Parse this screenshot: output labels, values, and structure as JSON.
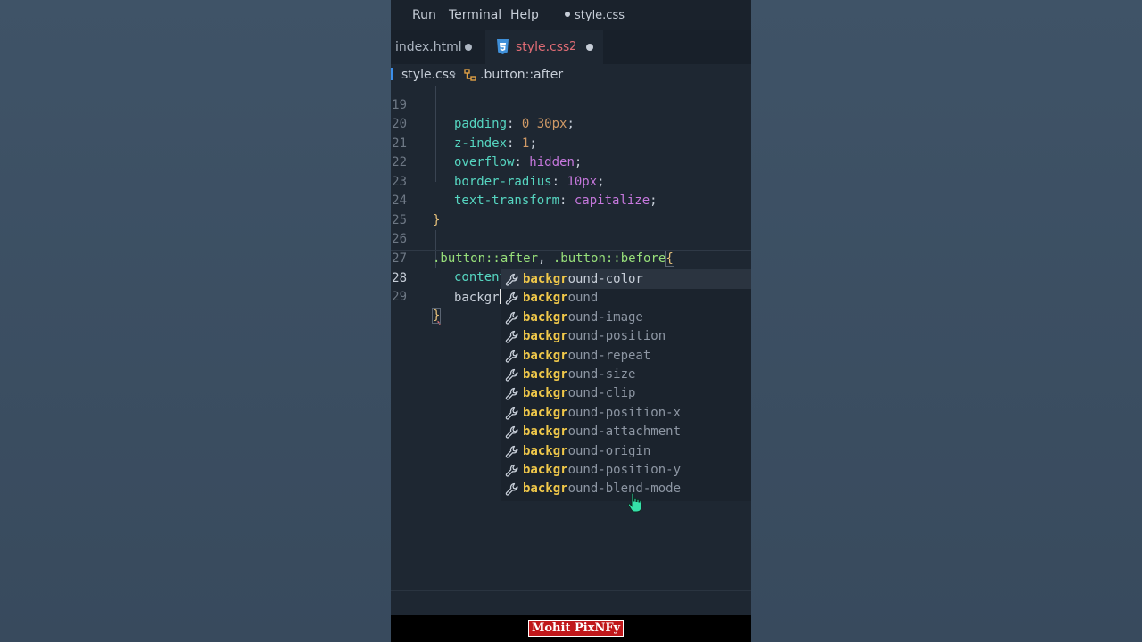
{
  "menu": {
    "run": "Run",
    "terminal": "Terminal",
    "help": "Help",
    "window_title": "style.css"
  },
  "tabs": [
    {
      "label": "index.html"
    },
    {
      "label": "style.css",
      "problems": "2"
    }
  ],
  "breadcrumb": {
    "file": "style.css",
    "separator": "›",
    "symbol": ".button::after"
  },
  "editor": {
    "line_numbers": [
      "19",
      "20",
      "21",
      "22",
      "23",
      "24",
      "25",
      "26",
      "27",
      "28",
      "29"
    ],
    "line19": {
      "prop": "padding",
      "colon": ": ",
      "val": "0 30px",
      "end": ";"
    },
    "line20": {
      "prop": "z-index",
      "colon": ": ",
      "val": "1",
      "end": ";"
    },
    "line21": {
      "prop": "overflow",
      "colon": ": ",
      "val": "hidden",
      "end": ";"
    },
    "line22": {
      "prop": "border-radius",
      "colon": ": ",
      "val": "10px",
      "end": ";"
    },
    "line23": {
      "prop": "text-transform",
      "colon": ": ",
      "val": "capitalize",
      "end": ";"
    },
    "line24": {
      "brace": "}"
    },
    "line26": {
      "sel1": ".button::after",
      "comma": ", ",
      "sel2": ".button::before",
      "brace": "{"
    },
    "line27": {
      "prop": "content",
      "colon": ": ",
      "val": "''",
      "end": ";"
    },
    "line28": {
      "typed": "backgr"
    },
    "line29": {
      "brace": "}"
    }
  },
  "suggestions": {
    "match": "backgr",
    "items": [
      {
        "rest": "ound-color"
      },
      {
        "rest": "ound"
      },
      {
        "rest": "ound-image"
      },
      {
        "rest": "ound-position"
      },
      {
        "rest": "ound-repeat"
      },
      {
        "rest": "ound-size"
      },
      {
        "rest": "ound-clip"
      },
      {
        "rest": "ound-position-x"
      },
      {
        "rest": "ound-attachment"
      },
      {
        "rest": "ound-origin"
      },
      {
        "rest": "ound-position-y"
      },
      {
        "rest": "ound-blend-mode"
      }
    ]
  },
  "watermark": "Mohit PixNFy"
}
